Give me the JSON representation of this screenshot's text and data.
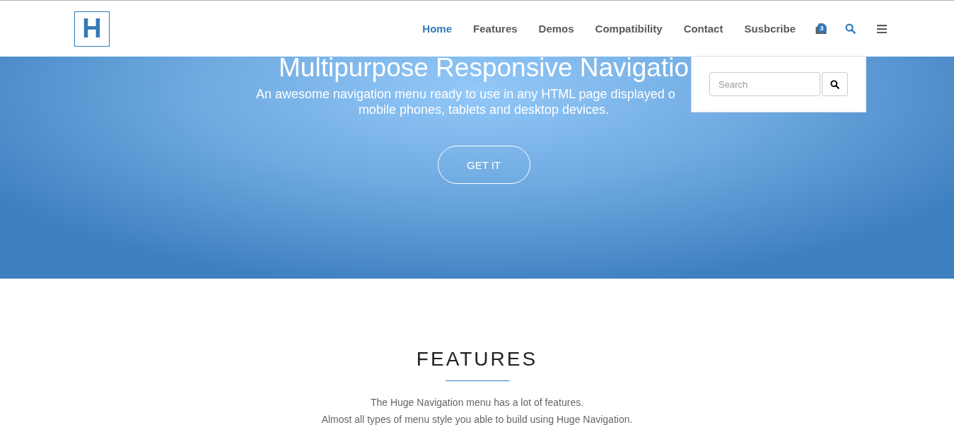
{
  "logo": {
    "letter": "H"
  },
  "nav": [
    {
      "label": "Home",
      "selected": true
    },
    {
      "label": "Features",
      "selected": false
    },
    {
      "label": "Demos",
      "selected": false
    },
    {
      "label": "Compatibility",
      "selected": false
    },
    {
      "label": "Contact",
      "selected": false
    },
    {
      "label": "Susbcribe",
      "selected": false
    }
  ],
  "cart": {
    "count": "3"
  },
  "search_toggle": {
    "expanded": true
  },
  "search_dropdown": {
    "placeholder": "Search"
  },
  "hero": {
    "title": "Multipurpose Responsive Navigatio",
    "subtitle_lines": [
      "An awesome navigation menu ready to use in any HTML page displayed o",
      "mobile phones, tablets and desktop devices."
    ],
    "button": "GET IT"
  },
  "features": {
    "title": "FEATURES",
    "lines": [
      "The Huge Navigation menu has a lot of features.",
      "Almost all types of menu style you able to build using Huge Navigation."
    ]
  }
}
